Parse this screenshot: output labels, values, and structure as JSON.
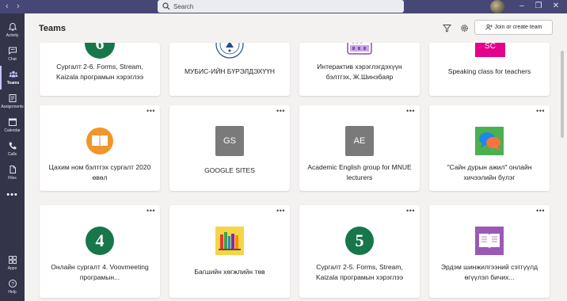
{
  "window": {
    "search_placeholder": "Search"
  },
  "rail": {
    "items": [
      {
        "label": "Activity",
        "icon": "bell-icon"
      },
      {
        "label": "Chat",
        "icon": "chat-icon"
      },
      {
        "label": "Teams",
        "icon": "teams-icon",
        "active": true
      },
      {
        "label": "Assignments",
        "icon": "assignments-icon"
      },
      {
        "label": "Calendar",
        "icon": "calendar-icon"
      },
      {
        "label": "Calls",
        "icon": "phone-icon"
      },
      {
        "label": "Files",
        "icon": "file-icon"
      },
      {
        "label": "Apps",
        "icon": "apps-icon"
      },
      {
        "label": "Help",
        "icon": "help-icon"
      }
    ],
    "more": "•••"
  },
  "header": {
    "title": "Teams",
    "join_button": "Join or create team"
  },
  "card_more": "•••",
  "teams": [
    {
      "name": "Сургалт 2-6. Forms, Stream, Kaizala програмын хэрэглээ",
      "logo": "number-6-badge",
      "color": "#17774a"
    },
    {
      "name": "МУБИС-ИЙН БҮРЭЛДЭХҮҮН",
      "logo": "university-seal",
      "color": "#1f4e8c"
    },
    {
      "name": "Интерактив хэрэглэгдэхүүн бэлтгэх, Ж.Шинэбаяр",
      "logo": "abacus-icon",
      "color": "#8a4db8"
    },
    {
      "name": "Speaking class for teachers",
      "logo": "SC",
      "color": "#e3008c"
    },
    {
      "name": "Цахим ном бэлтгэх сургалт 2020 өвөл",
      "logo": "open-book-icon",
      "color": "#f0962a"
    },
    {
      "name": "GOOGLE SITES",
      "logo": "GS",
      "color": "#7a7a7a"
    },
    {
      "name": "Academic English group for MNUE lecturers",
      "logo": "AE",
      "color": "#7a7a7a"
    },
    {
      "name": "\"Сайн дурын ажил\" онлайн хичээлийн бүлэг",
      "logo": "chat-bubbles-icon",
      "color": "#4caf50"
    },
    {
      "name": "Онлайн сургалт 4. Voovmeeting програмын...",
      "logo": "4",
      "color": "#17774a"
    },
    {
      "name": "Багшийн хөгжлийн төв",
      "logo": "bookshelf-icon",
      "color": "#f5d547"
    },
    {
      "name": "Сургалт 2-5. Forms, Stream, Kaizala програмын хэрэглээ",
      "logo": "5",
      "color": "#17774a"
    },
    {
      "name": "Эрдэм шинжилгээний сэтгүүлд өгүүлэл бичих...",
      "logo": "reading-book-icon",
      "color": "#9b59b6"
    }
  ]
}
